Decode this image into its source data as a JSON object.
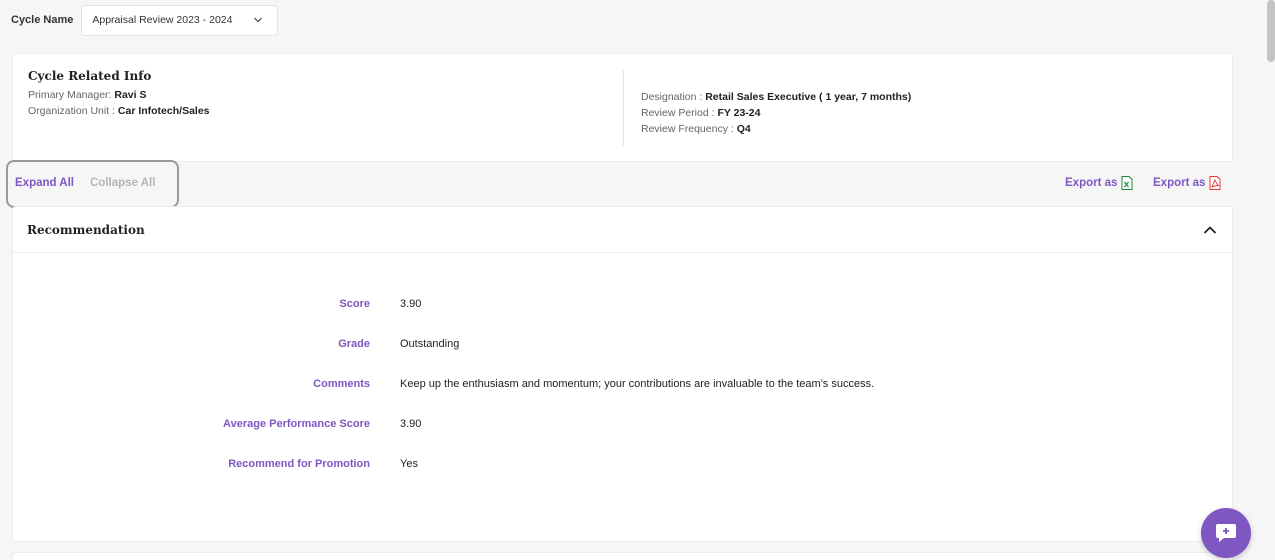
{
  "cycle": {
    "label": "Cycle Name",
    "selected": "Appraisal Review 2023 - 2024"
  },
  "info": {
    "title": "Cycle Related Info",
    "primary_manager_label": "Primary Manager:",
    "primary_manager_value": "Ravi S",
    "org_unit_label": "Organization Unit :",
    "org_unit_value": "Car Infotech/Sales",
    "designation_label": "Designation :",
    "designation_value": "Retail Sales Executive ( 1 year, 7 months)",
    "review_period_label": "Review Period :",
    "review_period_value": "FY 23-24",
    "review_frequency_label": "Review Frequency :",
    "review_frequency_value": "Q4"
  },
  "actions": {
    "expand_all": "Expand All",
    "collapse_all": "Collapse All",
    "export_excel": "Export as",
    "export_pdf": "Export as"
  },
  "recommendation": {
    "title": "Recommendation",
    "rows": [
      {
        "label": "Score",
        "value": "3.90"
      },
      {
        "label": "Grade",
        "value": "Outstanding"
      },
      {
        "label": "Comments",
        "value": "Keep up the enthusiasm and momentum; your contributions are invaluable to the team's success."
      },
      {
        "label": "Average Performance Score",
        "value": "3.90"
      },
      {
        "label": "Recommend for Promotion",
        "value": "Yes"
      }
    ]
  },
  "colors": {
    "accent": "#7e57c2",
    "excel": "#1d8a3a",
    "pdf": "#e53935"
  },
  "icons": [
    "chevron-down-icon",
    "chevron-up-icon",
    "excel-icon",
    "pdf-icon",
    "chat-icon"
  ]
}
